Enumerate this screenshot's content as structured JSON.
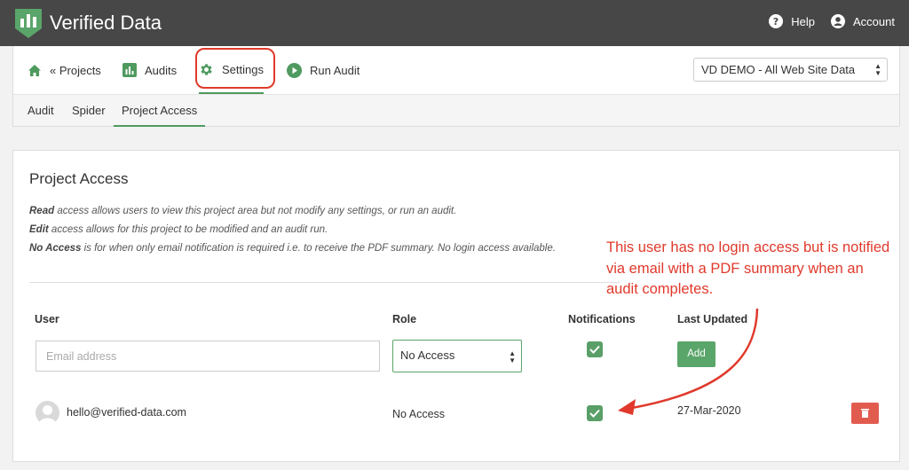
{
  "app": {
    "title": "Verified Data"
  },
  "topnav": {
    "help": "Help",
    "account": "Account"
  },
  "project_nav": {
    "tabs": [
      {
        "label": "« Projects",
        "icon": "home-icon"
      },
      {
        "label": "Audits",
        "icon": "bar-chart-icon"
      },
      {
        "label": "Settings",
        "icon": "gear-icon",
        "active": true
      },
      {
        "label": "Run Audit",
        "icon": "play-icon"
      }
    ],
    "project_select": "VD DEMO - All Web Site Data",
    "subtabs": [
      {
        "label": "Audit"
      },
      {
        "label": "Spider"
      },
      {
        "label": "Project Access",
        "active": true
      }
    ]
  },
  "panel": {
    "title": "Project Access",
    "descriptions": [
      {
        "term": "Read",
        "text": " access allows users to view this project area but not modify any settings, or run an audit."
      },
      {
        "term": "Edit",
        "text": " access allows for this project to be modified and an audit run."
      },
      {
        "term": "No Access",
        "text": " is for when only email notification is required i.e. to receive the PDF summary. No login access available."
      }
    ],
    "columns": {
      "user": "User",
      "role": "Role",
      "notifications": "Notifications",
      "last_updated": "Last Updated"
    },
    "new_user": {
      "email_placeholder": "Email address",
      "role": "No Access",
      "notifications": true,
      "add_label": "Add"
    },
    "rows": [
      {
        "email": "hello@verified-data.com",
        "role": "No Access",
        "notifications": true,
        "last_updated": "27-Mar-2020"
      }
    ]
  },
  "annotation": {
    "text": "This user has no login access but is notified via email with a PDF summary when an audit completes.",
    "color": "#e0392b"
  },
  "colors": {
    "brand_green": "#4f9a5f",
    "topbar": "#474747",
    "danger": "#e25b4f"
  }
}
